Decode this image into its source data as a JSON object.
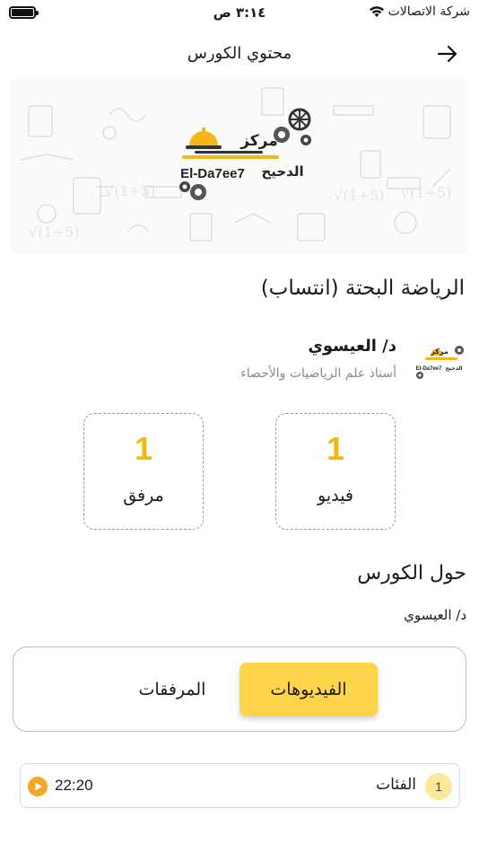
{
  "status_bar": {
    "carrier": "شركة الاتصالات",
    "time": "٣:١٤ ص"
  },
  "header": {
    "title": "محتوي الكورس"
  },
  "logo": {
    "arabic_top": "مركز",
    "arabic_bottom": "الدحيح",
    "latin": "El-Da7ee7"
  },
  "course": {
    "title": "الرياضة البحتة (انتساب)"
  },
  "teacher": {
    "name": "د/ العيسوي",
    "subtitle": "أستاذ علم الرياضيات والأحصاء"
  },
  "stats": {
    "videos": {
      "count": "1",
      "label": "فيديو"
    },
    "attachments": {
      "count": "1",
      "label": "مرفق"
    }
  },
  "about": {
    "title": "حول الكورس",
    "text": "د/ العيسوي"
  },
  "tabs": {
    "videos": "الفيديوهات",
    "attachments": "المرفقات",
    "active": "videos"
  },
  "videos": [
    {
      "index": "1",
      "name": "الفئات",
      "duration": "22:20"
    }
  ],
  "colors": {
    "accent": "#fdd44a",
    "number": "#f5b617",
    "play": "#f5a623"
  }
}
